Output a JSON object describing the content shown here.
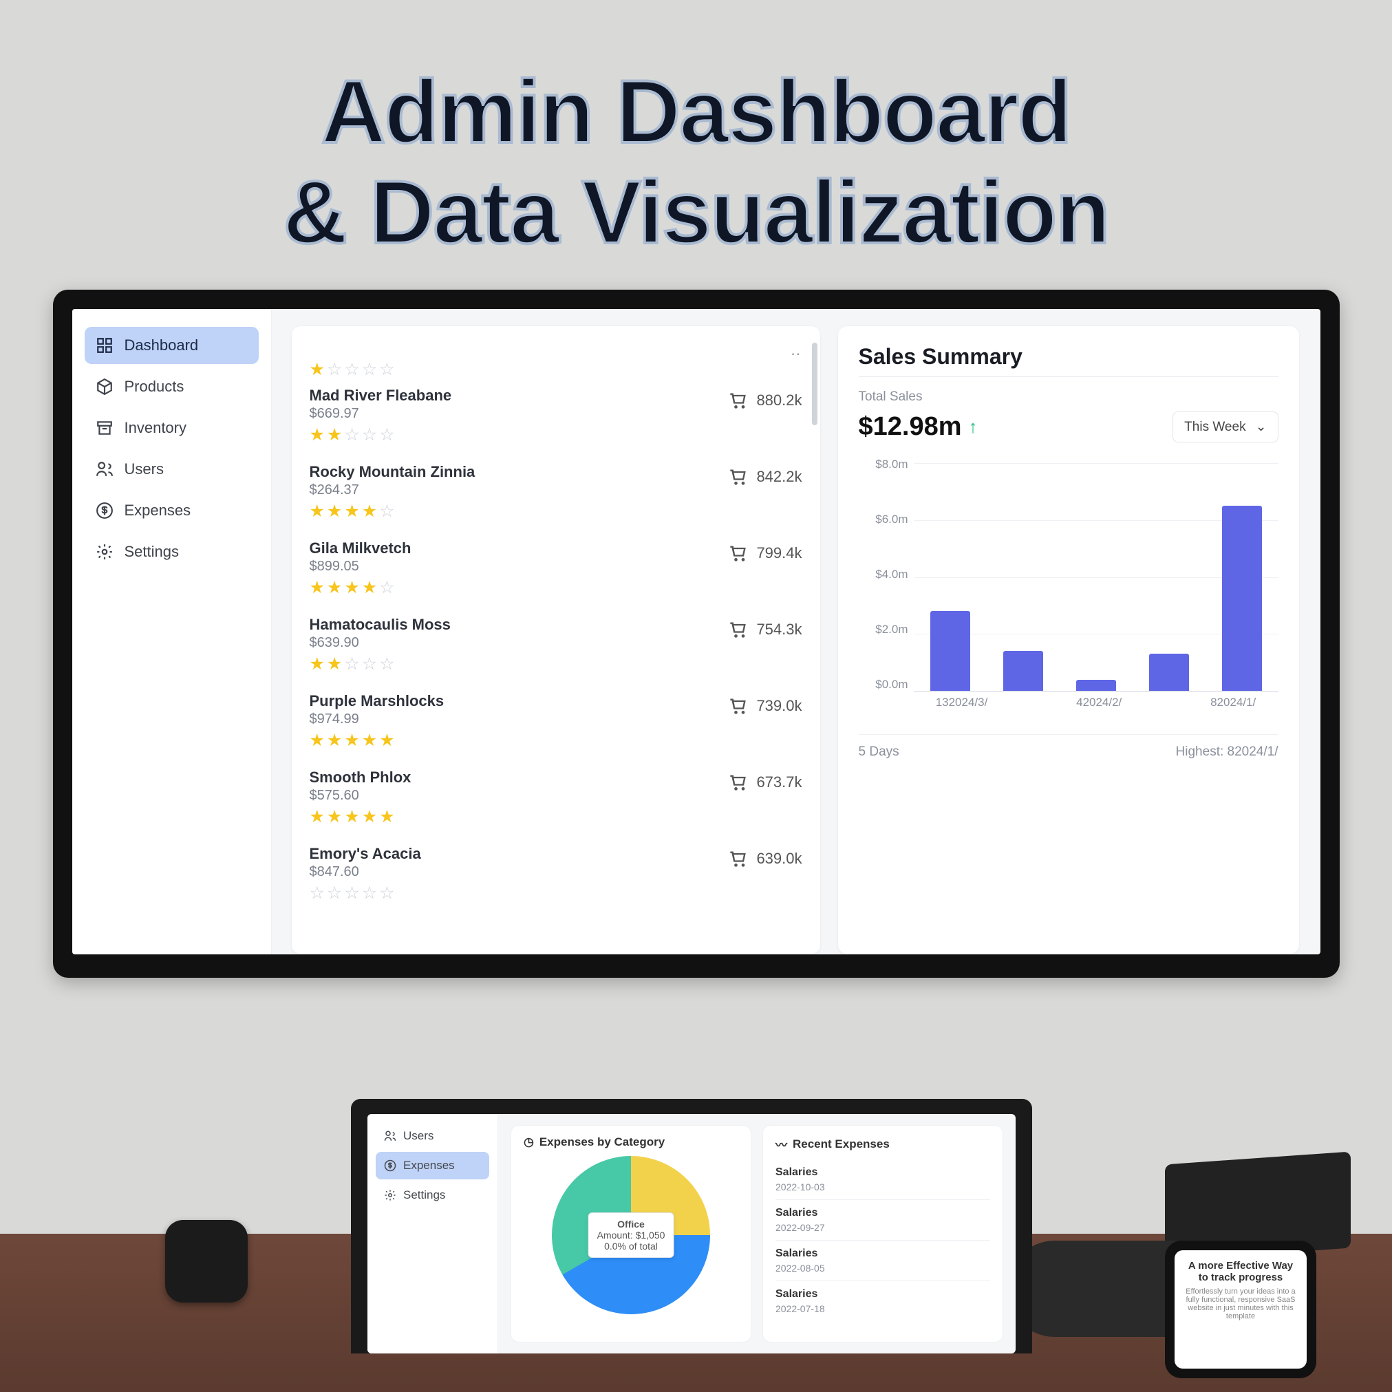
{
  "hero": {
    "line1": "Admin Dashboard",
    "line2": "& Data Visualization"
  },
  "sidebar": {
    "items": [
      {
        "label": "Dashboard",
        "active": true,
        "icon": "grid-icon"
      },
      {
        "label": "Products",
        "active": false,
        "icon": "cube-icon"
      },
      {
        "label": "Inventory",
        "active": false,
        "icon": "archive-icon"
      },
      {
        "label": "Users",
        "active": false,
        "icon": "users-icon"
      },
      {
        "label": "Expenses",
        "active": false,
        "icon": "dollar-icon"
      },
      {
        "label": "Settings",
        "active": false,
        "icon": "gear-icon"
      }
    ]
  },
  "products": [
    {
      "name": "Mad River Fleabane",
      "price": "$669.97",
      "rating_header": 1,
      "rating": 2,
      "count": "880.2k"
    },
    {
      "name": "Rocky Mountain Zinnia",
      "price": "$264.37",
      "rating": 4,
      "count": "842.2k"
    },
    {
      "name": "Gila Milkvetch",
      "price": "$899.05",
      "rating": 4,
      "count": "799.4k"
    },
    {
      "name": "Hamatocaulis Moss",
      "price": "$639.90",
      "rating": 2,
      "count": "754.3k"
    },
    {
      "name": "Purple Marshlocks",
      "price": "$974.99",
      "rating": 5,
      "count": "739.0k"
    },
    {
      "name": "Smooth Phlox",
      "price": "$575.60",
      "rating": 5,
      "count": "673.7k"
    },
    {
      "name": "Emory's Acacia",
      "price": "$847.60",
      "rating": 0,
      "count": "639.0k"
    }
  ],
  "sales": {
    "title": "Sales Summary",
    "subtitle": "Total Sales",
    "amount": "$12.98m",
    "trend": "up",
    "dropdown": "This Week",
    "footer_left": "5 Days",
    "footer_right": "Highest: 82024/1/"
  },
  "chart_data": {
    "type": "bar",
    "title": "Sales Summary",
    "ylabel": "",
    "ylim": [
      0,
      8
    ],
    "y_ticks": [
      "$8.0m",
      "$6.0m",
      "$4.0m",
      "$2.0m",
      "$0.0m"
    ],
    "categories": [
      "132024/3/",
      "",
      "42024/2/",
      "",
      "82024/1/"
    ],
    "values": [
      2.8,
      1.4,
      0.4,
      1.3,
      6.5
    ]
  },
  "laptop": {
    "sidebar": [
      {
        "label": "Users",
        "active": false,
        "icon": "users-icon"
      },
      {
        "label": "Expenses",
        "active": true,
        "icon": "dollar-icon"
      },
      {
        "label": "Settings",
        "active": false,
        "icon": "gear-icon"
      }
    ],
    "expenses_title": "Expenses by Category",
    "recent_title": "Recent Expenses",
    "pie_tooltip": {
      "cat": "Office",
      "amount": "Amount: $1,050",
      "pct": "0.0% of total"
    },
    "recent": [
      {
        "name": "Salaries",
        "date": "2022-10-03"
      },
      {
        "name": "Salaries",
        "date": "2022-09-27"
      },
      {
        "name": "Salaries",
        "date": "2022-08-05"
      },
      {
        "name": "Salaries",
        "date": "2022-07-18"
      }
    ]
  },
  "phone": {
    "title": "A more Effective Way to track progress",
    "body": "Effortlessly turn your ideas into a fully functional, responsive SaaS website in just minutes with this template"
  }
}
